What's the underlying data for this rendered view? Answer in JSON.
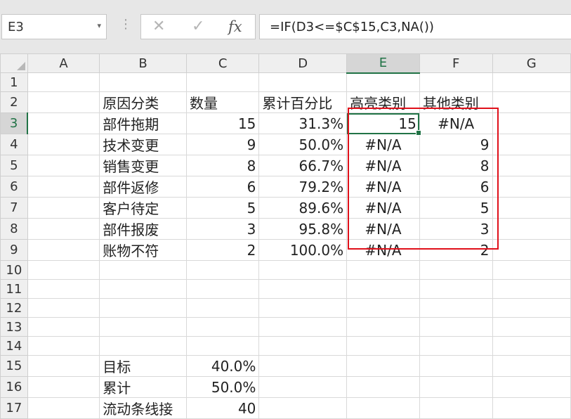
{
  "formula_bar": {
    "name_box": "E3",
    "name_box_dropdown_glyph": "▾",
    "cancel_glyph": "✕",
    "enter_glyph": "✓",
    "fx_label": "fx",
    "formula": "=IF(D3<=$C$15,C3,NA())"
  },
  "columns": [
    "A",
    "B",
    "C",
    "D",
    "E",
    "F",
    "G"
  ],
  "rows": [
    {
      "n": "1",
      "b": "",
      "c": "",
      "d": "",
      "e": "",
      "f": ""
    },
    {
      "n": "2",
      "b": "原因分类",
      "c": "数量",
      "d": "累计百分比",
      "e": "高亮类别",
      "f": "其他类别"
    },
    {
      "n": "3",
      "b": "部件拖期",
      "c": "15",
      "d": "31.3%",
      "e": "15",
      "f": "#N/A"
    },
    {
      "n": "4",
      "b": "技术变更",
      "c": "9",
      "d": "50.0%",
      "e": "#N/A",
      "f": "9"
    },
    {
      "n": "5",
      "b": "销售变更",
      "c": "8",
      "d": "66.7%",
      "e": "#N/A",
      "f": "8"
    },
    {
      "n": "6",
      "b": "部件返修",
      "c": "6",
      "d": "79.2%",
      "e": "#N/A",
      "f": "6"
    },
    {
      "n": "7",
      "b": "客户待定",
      "c": "5",
      "d": "89.6%",
      "e": "#N/A",
      "f": "5"
    },
    {
      "n": "8",
      "b": "部件报废",
      "c": "3",
      "d": "95.8%",
      "e": "#N/A",
      "f": "3"
    },
    {
      "n": "9",
      "b": "账物不符",
      "c": "2",
      "d": "100.0%",
      "e": "#N/A",
      "f": "2"
    },
    {
      "n": "10",
      "b": "",
      "c": "",
      "d": "",
      "e": "",
      "f": ""
    },
    {
      "n": "11",
      "b": "",
      "c": "",
      "d": "",
      "e": "",
      "f": ""
    },
    {
      "n": "12",
      "b": "",
      "c": "",
      "d": "",
      "e": "",
      "f": ""
    },
    {
      "n": "13",
      "b": "",
      "c": "",
      "d": "",
      "e": "",
      "f": ""
    },
    {
      "n": "14",
      "b": "",
      "c": "",
      "d": "",
      "e": "",
      "f": ""
    },
    {
      "n": "15",
      "b": "目标",
      "c": "40.0%",
      "d": "",
      "e": "",
      "f": ""
    },
    {
      "n": "16",
      "b": "累计",
      "c": "50.0%",
      "d": "",
      "e": "",
      "f": ""
    },
    {
      "n": "17",
      "b": "流动条线接",
      "c": "40",
      "d": "",
      "e": "",
      "f": ""
    }
  ],
  "colors": {
    "selection": "#217346",
    "highlight_box": "#e0101a"
  }
}
